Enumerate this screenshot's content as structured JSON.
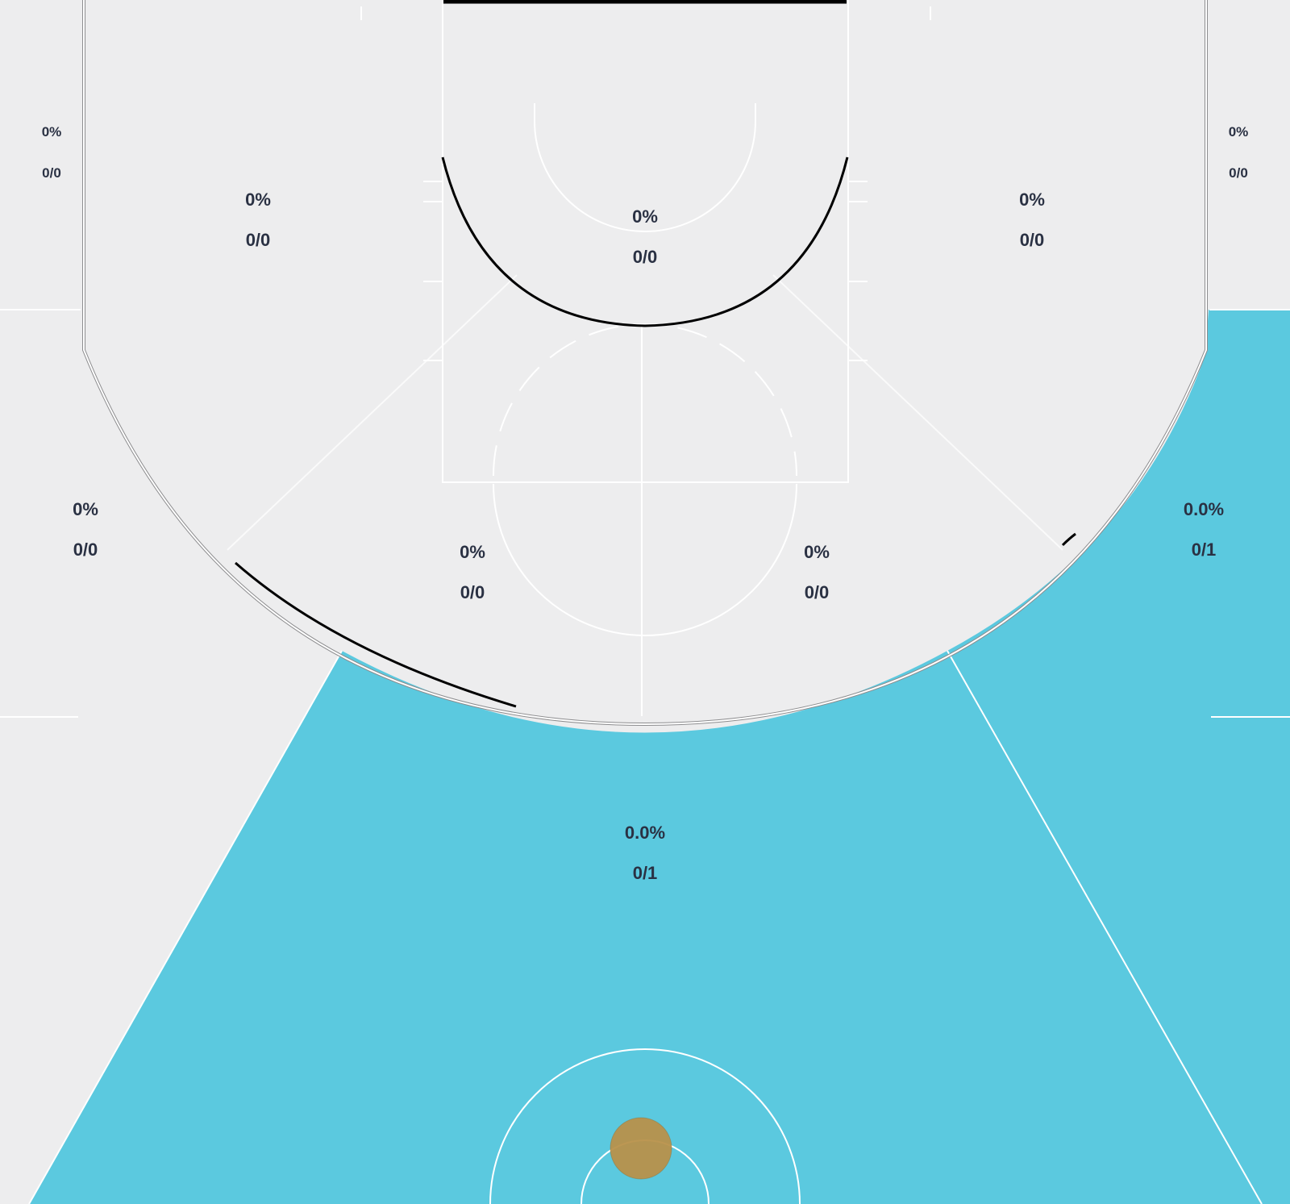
{
  "colors": {
    "background": "#ededee",
    "hot_zone": "#5bc9df",
    "court_lines": "#ffffff",
    "label_text": "#2a3143",
    "ball": "#b8914a"
  },
  "zones": {
    "left_corner_three": {
      "pct": "0%",
      "made_attempted": "0/0"
    },
    "right_corner_three": {
      "pct": "0%",
      "made_attempted": "0/0"
    },
    "left_baseline_mid": {
      "pct": "0%",
      "made_attempted": "0/0"
    },
    "right_baseline_mid": {
      "pct": "0%",
      "made_attempted": "0/0"
    },
    "paint": {
      "pct": "0%",
      "made_attempted": "0/0"
    },
    "left_elbow_mid": {
      "pct": "0%",
      "made_attempted": "0/0"
    },
    "right_elbow_mid": {
      "pct": "0%",
      "made_attempted": "0/0"
    },
    "left_wing_three": {
      "pct": "0%",
      "made_attempted": "0/0"
    },
    "right_wing_three": {
      "pct": "0.0%",
      "made_attempted": "0/1"
    },
    "top_key_three": {
      "pct": "0.0%",
      "made_attempted": "0/1"
    }
  },
  "hot_zones": [
    "right_wing_three",
    "top_key_three"
  ],
  "icons": {
    "ball": "basketball-icon"
  }
}
